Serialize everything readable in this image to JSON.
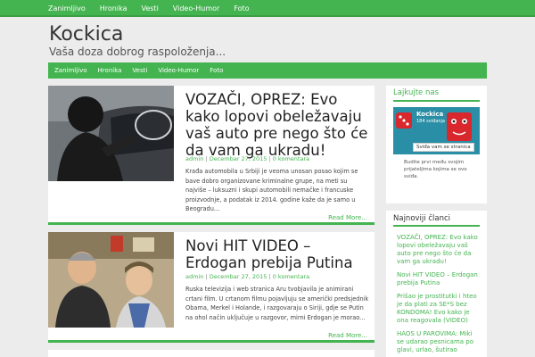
{
  "topnav": [
    "Zanimljivo",
    "Hronika",
    "Vesti",
    "Video-Humor",
    "Foto"
  ],
  "site": {
    "title": "Kockica",
    "description": "Vaša doza dobrog raspoloženja..."
  },
  "mainnav": [
    "Zanimljivo",
    "Hronika",
    "Vesti",
    "Video-Humor",
    "Foto"
  ],
  "posts": [
    {
      "title": "VOZAČI, OPREZ: Evo kako lopovi obeležavaju vaš auto pre nego što će da vam ga ukradu!",
      "author": "admin",
      "date": "Decembar 27, 2015",
      "comments": "0 komentara",
      "excerpt": "Krađa automobila u Srbiji je veoma unosan posao kojim se bave dobro organizovane kriminalne grupe, na meti su najviše – luksuzni i skupi automobili nemačke i francuske proizvodnje, a podatak iz 2014. godine kaže da je samo u Beogradu...",
      "readmore": "Read More..."
    },
    {
      "title": "Novi HIT VIDEO – Erdogan prebija Putina",
      "author": "admin",
      "date": "Decembar 27, 2015",
      "comments": "0 komentara",
      "excerpt": "Ruska televizija i web stranica Aru tvobjavila je animirani crtani film. U crtanom filmu pojavljuju se američki predsjednik Obama, Merkel i Holande, i razgovaraju o Siriji, gdje se Putin na ohol način uključuje u razgovor, mirni Erdogan je morao...",
      "readmore": "Read More..."
    }
  ],
  "sidebar": {
    "like_title": "Lajkujte nas",
    "fb_name": "Kockica",
    "fb_count": "184 sviđanja",
    "fb_like": "Sviđa vam se stranica",
    "fb_text": "Budite prvi među svojim prijateljima kojima se ovo sviđa.",
    "latest_title": "Najnoviji članci",
    "latest": [
      "VOZAČI, OPREZ: Evo kako lopovi obeležavaju vaš auto pre nego što će da vam ga ukradu!",
      "Novi HIT VIDEO – Erdogan prebija Putina",
      "Prišao je prostitutki i hteo je da plati za SE*S bez KONDOMA! Evo kako je ona reagovala (VIDEO)",
      "HAOS U PAROVIMA: Miki se udarao pesnicama po glavi, urlao, šutirao"
    ]
  },
  "colors": {
    "accent": "#44b450",
    "background": "#ececec"
  }
}
